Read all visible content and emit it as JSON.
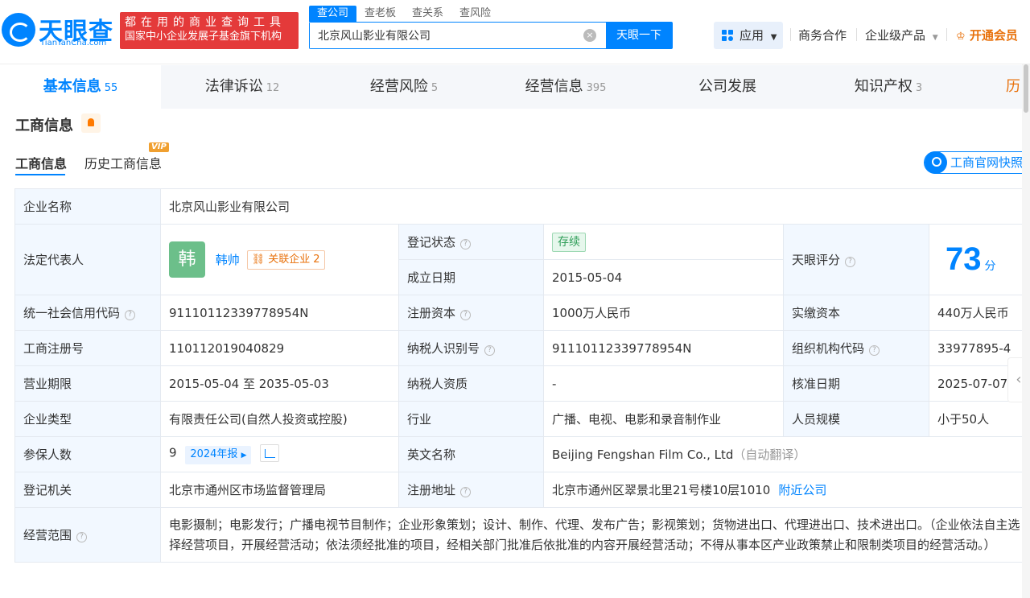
{
  "header": {
    "logo_cn": "天眼查",
    "logo_en": "TianYanCha.com",
    "slogan_line1": "都在用的商业查询工具",
    "slogan_line2": "国家中小企业发展子基金旗下机构",
    "search_tabs": [
      "查公司",
      "查老板",
      "查关系",
      "查风险"
    ],
    "search_value": "北京风山影业有限公司",
    "clear_icon": "×",
    "search_button": "天眼一下",
    "app_button": "应用",
    "nav": [
      "商务合作",
      "企业级产品"
    ],
    "vip": "开通会员"
  },
  "main_tabs": [
    {
      "label": "基本信息",
      "count": "55"
    },
    {
      "label": "法律诉讼",
      "count": "12"
    },
    {
      "label": "经营风险",
      "count": "5"
    },
    {
      "label": "经营信息",
      "count": "395"
    },
    {
      "label": "公司发展",
      "count": ""
    },
    {
      "label": "知识产权",
      "count": "3"
    },
    {
      "label": "历",
      "count": ""
    }
  ],
  "section": {
    "title": "工商信息",
    "subtabs": [
      "工商信息",
      "历史工商信息"
    ],
    "vip_badge": "VIP",
    "snapshot_button": "工商官网快照"
  },
  "info": {
    "company_name_label": "企业名称",
    "company_name": "北京风山影业有限公司",
    "legal_rep_label": "法定代表人",
    "legal_rep_avatar": "韩",
    "legal_rep_name": "韩帅",
    "assoc_label": "关联企业",
    "assoc_count": "2",
    "reg_status_label": "登记状态",
    "reg_status": "存续",
    "founded_label": "成立日期",
    "founded": "2015-05-04",
    "score_label": "天眼评分",
    "score": "73",
    "score_unit": "分",
    "credit_code_label": "统一社会信用代码",
    "credit_code": "91110112339778954N",
    "reg_capital_label": "注册资本",
    "reg_capital": "1000万人民币",
    "paid_capital_label": "实缴资本",
    "paid_capital": "440万人民币",
    "biz_reg_no_label": "工商注册号",
    "biz_reg_no": "110112019040829",
    "taxpayer_id_label": "纳税人识别号",
    "taxpayer_id": "91110112339778954N",
    "org_code_label": "组织机构代码",
    "org_code": "33977895-4",
    "term_label": "营业期限",
    "term": "2015-05-04 至 2035-05-03",
    "taxpayer_qual_label": "纳税人资质",
    "taxpayer_qual": "-",
    "approval_date_label": "核准日期",
    "approval_date": "2025-07-07",
    "type_label": "企业类型",
    "type": "有限责任公司(自然人投资或控股)",
    "industry_label": "行业",
    "industry": "广播、电视、电影和录音制作业",
    "staff_label": "人员规模",
    "staff": "小于50人",
    "insured_label": "参保人数",
    "insured": "9",
    "insured_year": "2024年报",
    "english_name_label": "英文名称",
    "english_name": "Beijing Fengshan Film Co., Ltd",
    "english_name_note": "（自动翻译）",
    "authority_label": "登记机关",
    "authority": "北京市通州区市场监督管理局",
    "address_label": "注册地址",
    "address": "北京市通州区翠景北里21号楼10层1010",
    "nearby_link": "附近公司",
    "scope_label": "经营范围",
    "scope": "电影摄制；电影发行；广播电视节目制作；企业形象策划；设计、制作、代理、发布广告；影视策划；货物进出口、代理进出口、技术进出口。（企业依法自主选择经营项目，开展经营活动；依法须经批准的项目，经相关部门批准后依批准的内容开展经营活动；不得从事本区产业政策禁止和限制类项目的经营活动。）"
  }
}
